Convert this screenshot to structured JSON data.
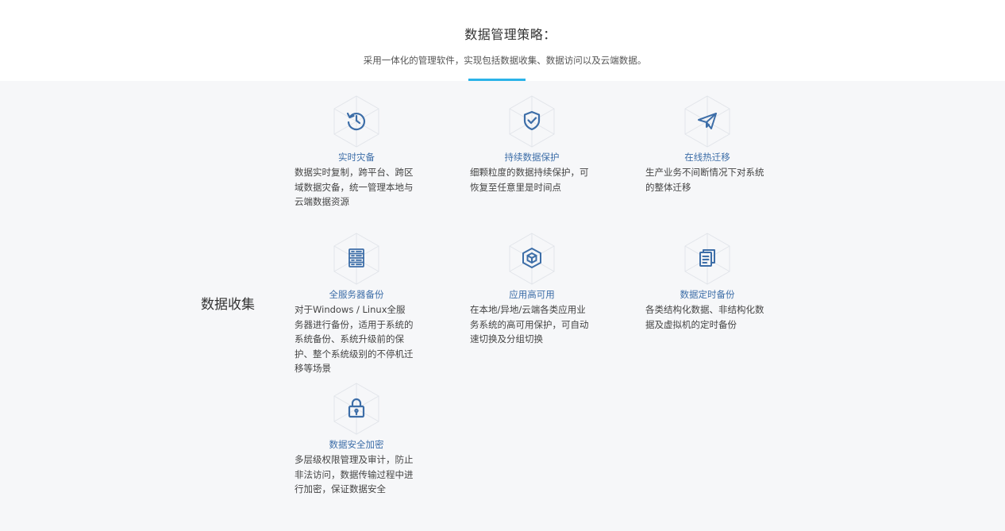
{
  "header": {
    "title": "数据管理策略：",
    "subtitle": "采用一体化的管理软件，实现包括数据收集、数据访问以及云端数据。"
  },
  "section": {
    "label": "数据收集"
  },
  "features": [
    {
      "title": "实时灾备",
      "desc": "数据实时复制，跨平台、跨区域数据灾备，统一管理本地与云端数据资源",
      "icon": "history-clock-icon"
    },
    {
      "title": "持续数据保护",
      "desc": "细颗粒度的数据持续保护，可恢复至任意里是时间点",
      "icon": "shield-check-icon"
    },
    {
      "title": "在线热迁移",
      "desc": "生产业务不间断情况下对系统的整体迁移",
      "icon": "paper-plane-icon"
    },
    {
      "title": "全服务器备份",
      "desc": "对于Windows / Linux全服务器进行备份，适用于系统的系统备份、系统升级前的保护、整个系统级别的不停机迁移等场景",
      "icon": "server-rack-icon"
    },
    {
      "title": "应用高可用",
      "desc": "在本地/异地/云端各类应用业务系统的高可用保护，可自动速切换及分组切换",
      "icon": "cube-icon"
    },
    {
      "title": "数据定时备份",
      "desc": "各类结构化数据、非结构化数据及虚拟机的定时备份",
      "icon": "documents-icon"
    },
    {
      "title": "数据安全加密",
      "desc": "多层级权限管理及审计，防止非法访问，数据传输过程中进行加密，保证数据安全",
      "icon": "lock-icon"
    }
  ],
  "colors": {
    "accent": "#2bb3e8",
    "icon_blue": "#3d6ea8",
    "background": "#f6f7f9"
  }
}
